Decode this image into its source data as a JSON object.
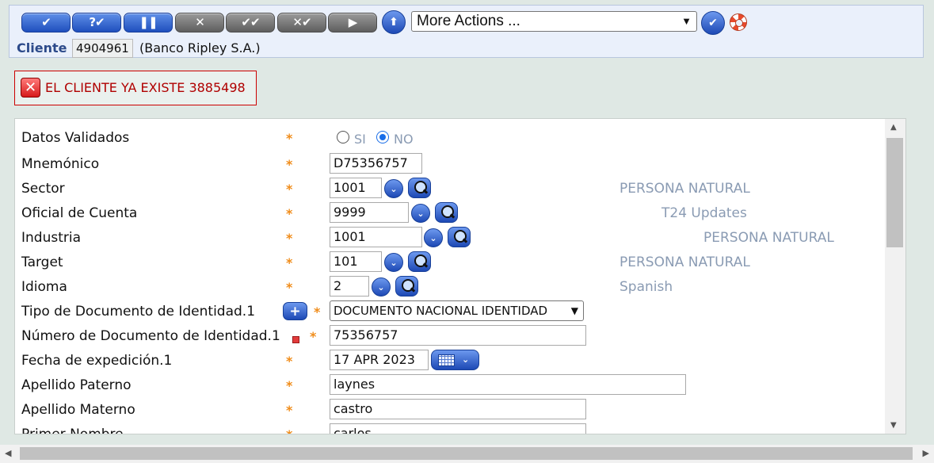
{
  "toolbar": {
    "commit_icon": "✔",
    "validate_icon": "?✔",
    "hold_icon": "❚❚",
    "delete_icon": "✕",
    "authorise_icon": "✔✔",
    "reverse_icon": "✕✔",
    "next_icon": "▶",
    "up_icon": "⬆",
    "more_actions": "More Actions ...",
    "go_icon": "✔",
    "colors": {
      "active": "#1f4fbd",
      "inactive": "#5e5e5e"
    }
  },
  "cliente": {
    "label": "Cliente",
    "id": "4904961",
    "name": "(Banco Ripley S.A.)"
  },
  "error": {
    "icon": "✕",
    "message": "EL CLIENTE YA EXISTE 3885498",
    "color": "#b00000"
  },
  "form": {
    "datos_validados": {
      "label": "Datos Validados",
      "opt_si": "SI",
      "opt_no": "NO",
      "selected": "NO"
    },
    "mnemonico": {
      "label": "Mnemónico",
      "value": "D75356757"
    },
    "sector": {
      "label": "Sector",
      "value": "1001",
      "desc": "PERSONA NATURAL"
    },
    "oficial": {
      "label": "Oficial de Cuenta",
      "value": "9999",
      "desc": "T24 Updates"
    },
    "industria": {
      "label": "Industria",
      "value": "1001",
      "desc": "PERSONA NATURAL"
    },
    "target": {
      "label": "Target",
      "value": "101",
      "desc": "PERSONA NATURAL"
    },
    "idioma": {
      "label": "Idioma",
      "value": "2",
      "desc": "Spanish"
    },
    "tipo_doc": {
      "label": "Tipo de Documento de Identidad.1",
      "value": "DOCUMENTO NACIONAL IDENTIDAD",
      "plus": "+"
    },
    "num_doc": {
      "label": "Número de Documento de Identidad.1",
      "value": "75356757"
    },
    "fecha_exp": {
      "label": "Fecha de expedición.1",
      "value": "17 APR 2023"
    },
    "apellido_paterno": {
      "label": "Apellido Paterno",
      "value": "laynes"
    },
    "apellido_materno": {
      "label": "Apellido Materno",
      "value": "castro"
    },
    "primer_nombre": {
      "label": "Primer Nombre",
      "value": "carlos"
    },
    "star": "*",
    "dd_icon": "⌄",
    "caret": "⌄",
    "star_color": "#f08c1a",
    "desc_color": "#8a9bb3"
  },
  "scroll": {
    "up": "▲",
    "down": "▼",
    "left": "◀",
    "right": "▶"
  }
}
